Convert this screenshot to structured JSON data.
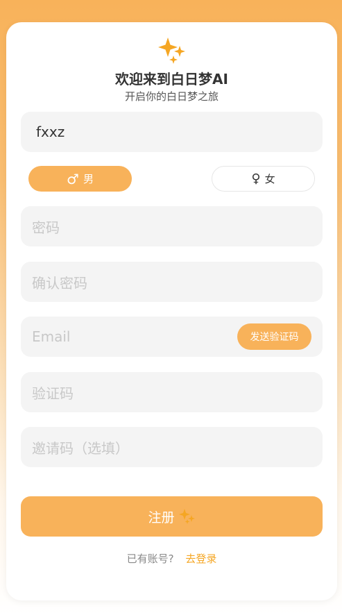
{
  "header": {
    "title": "欢迎来到白日梦AI",
    "subtitle": "开启你的白日梦之旅"
  },
  "form": {
    "username": {
      "value": "fxxz"
    },
    "gender": {
      "male": {
        "symbol": "♂",
        "label": "男"
      },
      "female": {
        "symbol": "♀",
        "label": "女"
      },
      "selected": "male"
    },
    "password": {
      "placeholder": "密码"
    },
    "confirm_password": {
      "placeholder": "确认密码"
    },
    "email": {
      "placeholder": "Email",
      "send_code_label": "发送验证码"
    },
    "code": {
      "placeholder": "验证码"
    },
    "invite": {
      "placeholder": "邀请码（选填）"
    },
    "register_label": "注册"
  },
  "footer": {
    "question": "已有账号?",
    "login_link": "去登录"
  },
  "colors": {
    "accent": "#F8B25A",
    "link": "#F5A623",
    "sparkle": "#F5A623"
  },
  "icons": {
    "logo": "sparkles-icon",
    "register": "sparkles-icon"
  }
}
